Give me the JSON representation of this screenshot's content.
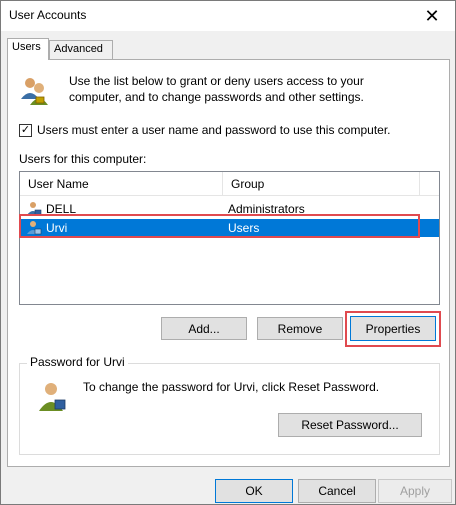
{
  "window": {
    "title": "User Accounts",
    "close_glyph": "✕"
  },
  "tabs": [
    {
      "label": "Users",
      "active": true
    },
    {
      "label": "Advanced",
      "active": false
    }
  ],
  "intro": {
    "text": "Use the list below to grant or deny users access to your computer, and to change passwords and other settings.",
    "icon": "users-icon"
  },
  "require_login": {
    "label": "Users must enter a user name and password to use this computer.",
    "checked": true
  },
  "users_list": {
    "label": "Users for this computer:",
    "columns": [
      "User Name",
      "Group"
    ],
    "rows": [
      {
        "name": "DELL",
        "group": "Administrators",
        "selected": false
      },
      {
        "name": "Urvi",
        "group": "Users",
        "selected": true
      }
    ]
  },
  "list_buttons": {
    "add": "Add...",
    "remove": "Remove",
    "properties": "Properties"
  },
  "password_group": {
    "legend": "Password for Urvi",
    "text": "To change the password for Urvi, click Reset Password.",
    "reset_button": "Reset Password..."
  },
  "dialog_buttons": {
    "ok": "OK",
    "cancel": "Cancel",
    "apply": "Apply"
  },
  "colors": {
    "selection": "#0078d7",
    "highlight_annotation": "#e04a4f"
  }
}
